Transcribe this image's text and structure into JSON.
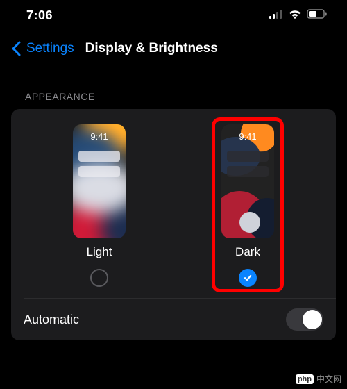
{
  "status": {
    "time": "7:06"
  },
  "nav": {
    "back": "Settings",
    "title": "Display & Brightness"
  },
  "section": {
    "appearance_header": "APPEARANCE"
  },
  "appearance": {
    "options": [
      {
        "label": "Light",
        "preview_time": "9:41",
        "selected": false
      },
      {
        "label": "Dark",
        "preview_time": "9:41",
        "selected": true
      }
    ]
  },
  "automatic": {
    "label": "Automatic",
    "on": false
  },
  "watermark": {
    "logo": "php",
    "text": "中文网"
  }
}
